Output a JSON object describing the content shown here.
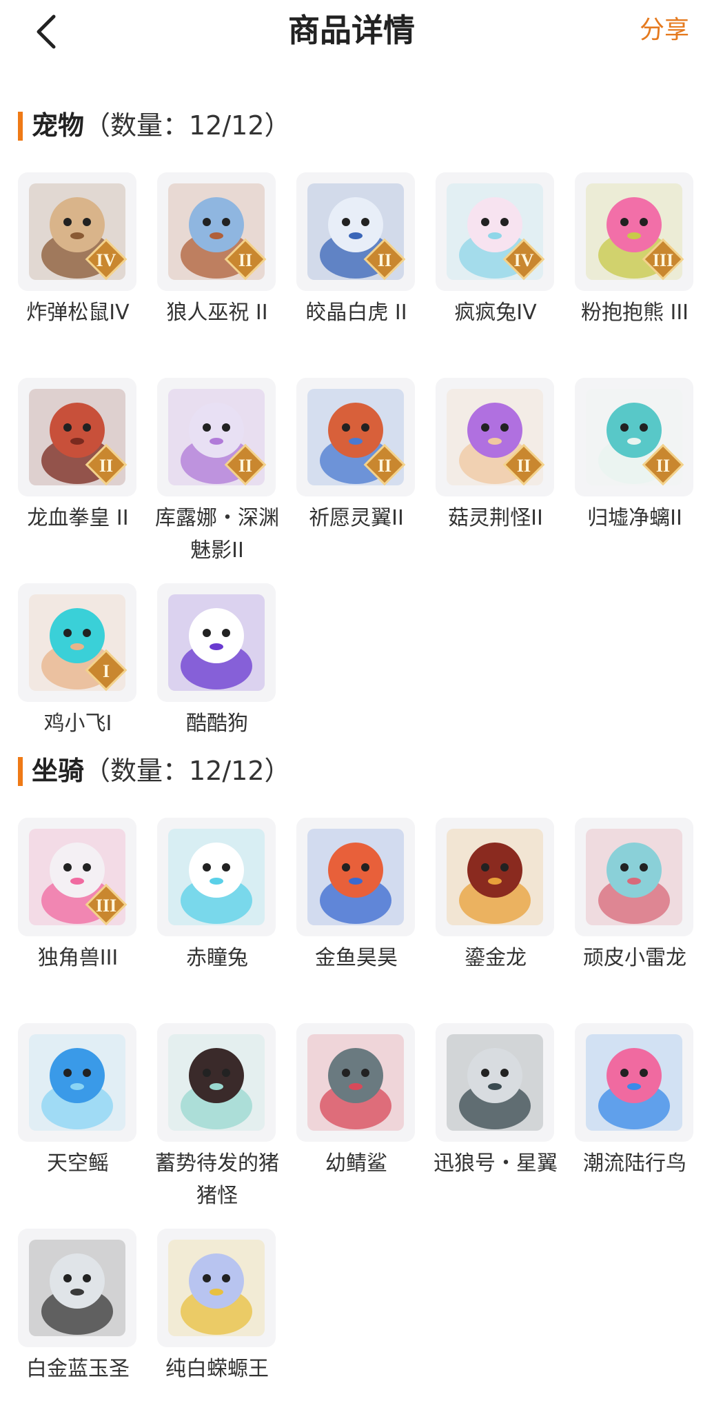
{
  "header": {
    "title": "商品详情",
    "share_label": "分享"
  },
  "colors": {
    "accent": "#ef7a16",
    "share_text": "#e57a1f",
    "thumb_bg": "#f4f4f6"
  },
  "sections": [
    {
      "title": "宠物",
      "count_text": "（数量：12/12）",
      "items": [
        {
          "name": "炸弹松鼠IV",
          "icon": "squirrel-icon",
          "badge": "IV"
        },
        {
          "name": "狼人巫祝 II",
          "icon": "werewolf-icon",
          "badge": "II"
        },
        {
          "name": "皎晶白虎 II",
          "icon": "white-tiger-icon",
          "badge": "II"
        },
        {
          "name": "疯疯兔IV",
          "icon": "rabbit-icon",
          "badge": "IV"
        },
        {
          "name": "粉抱抱熊 III",
          "icon": "pink-bear-icon",
          "badge": "III"
        },
        {
          "name": "龙血拳皇 II",
          "icon": "dragon-boxer-icon",
          "badge": "II"
        },
        {
          "name": "库露娜・深渊魅影II",
          "icon": "kuluna-icon",
          "badge": "II"
        },
        {
          "name": "祈愿灵翼II",
          "icon": "eagle-icon",
          "badge": "II"
        },
        {
          "name": "菇灵荆怪II",
          "icon": "mushroom-sprite-icon",
          "badge": "II"
        },
        {
          "name": "归墟净螭II",
          "icon": "water-dragon-icon",
          "badge": "II"
        },
        {
          "name": "鸡小飞I",
          "icon": "chick-icon",
          "badge": "I"
        },
        {
          "name": "酷酷狗",
          "icon": "cool-dog-icon",
          "badge": ""
        }
      ]
    },
    {
      "title": "坐骑",
      "count_text": "（数量：12/12）",
      "items": [
        {
          "name": "独角兽III",
          "icon": "unicorn-icon",
          "badge": "III"
        },
        {
          "name": "赤瞳兔",
          "icon": "red-eye-rabbit-icon",
          "badge": ""
        },
        {
          "name": "金鱼昊昊",
          "icon": "goldfish-icon",
          "badge": ""
        },
        {
          "name": "鎏金龙",
          "icon": "gilded-dragon-icon",
          "badge": ""
        },
        {
          "name": "顽皮小雷龙",
          "icon": "brontosaurus-icon",
          "badge": ""
        },
        {
          "name": "天空鳐",
          "icon": "sky-ray-icon",
          "badge": ""
        },
        {
          "name": "蓄势待发的猪猪怪",
          "icon": "pig-icon",
          "badge": ""
        },
        {
          "name": "幼鲭鲨",
          "icon": "shark-icon",
          "badge": ""
        },
        {
          "name": "迅狼号・星翼",
          "icon": "mecha-wolf-icon",
          "badge": ""
        },
        {
          "name": "潮流陆行鸟",
          "icon": "trendy-bird-icon",
          "badge": ""
        },
        {
          "name": "白金蓝玉圣",
          "icon": "platinum-mount-icon",
          "badge": ""
        },
        {
          "name": "纯白蝾螈王",
          "icon": "axolotl-icon",
          "badge": ""
        }
      ]
    }
  ]
}
